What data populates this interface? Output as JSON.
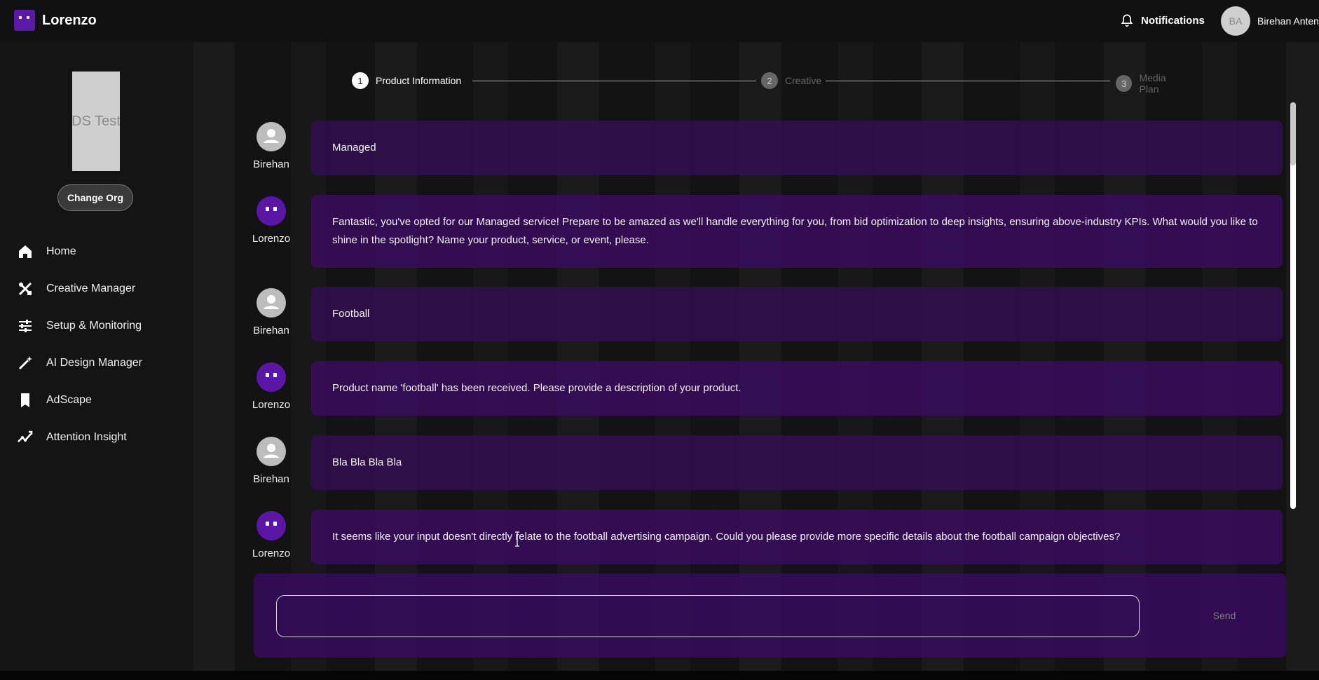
{
  "app": {
    "name": "Lorenzo",
    "accent": "#5b1aa8"
  },
  "header": {
    "notifications_label": "Notifications",
    "user_initials": "BA",
    "user_name": "Birehan Antene"
  },
  "sidebar": {
    "org_logo_text": "DS Test",
    "change_org_label": "Change Org",
    "items": [
      {
        "label": "Home",
        "icon": "home-icon"
      },
      {
        "label": "Creative Manager",
        "icon": "tools-icon"
      },
      {
        "label": "Setup & Monitoring",
        "icon": "sliders-icon"
      },
      {
        "label": "AI Design Manager",
        "icon": "magic-wand-icon"
      },
      {
        "label": "AdScape",
        "icon": "bookmark-icon"
      },
      {
        "label": "Attention Insight",
        "icon": "trend-icon"
      }
    ]
  },
  "stepper": {
    "steps": [
      {
        "num": "1",
        "label": "Product Information",
        "state": "active"
      },
      {
        "num": "2",
        "label": "Creative",
        "state": "inactive"
      },
      {
        "num": "3",
        "label": "Media Plan",
        "state": "inactive"
      }
    ]
  },
  "chat": {
    "messages": [
      {
        "author": "Birehan",
        "role": "user",
        "text": "Managed"
      },
      {
        "author": "Lorenzo",
        "role": "bot",
        "text": "Fantastic, you've opted for our Managed service! Prepare to be amazed as we'll handle everything for you, from bid optimization to deep insights, ensuring above-industry KPIs. What would you like to shine in the spotlight? Name your product, service, or event, please."
      },
      {
        "author": "Birehan",
        "role": "user",
        "text": "Football"
      },
      {
        "author": "Lorenzo",
        "role": "bot",
        "text": "Product name 'football' has been received. Please provide a description of your product."
      },
      {
        "author": "Birehan",
        "role": "user",
        "text": "Bla Bla Bla Bla"
      },
      {
        "author": "Lorenzo",
        "role": "bot",
        "text": "It seems like your input doesn't directly relate to the football advertising campaign. Could you please provide more specific details about the football campaign objectives?"
      }
    ]
  },
  "composer": {
    "value": "",
    "send_label": "Send"
  }
}
